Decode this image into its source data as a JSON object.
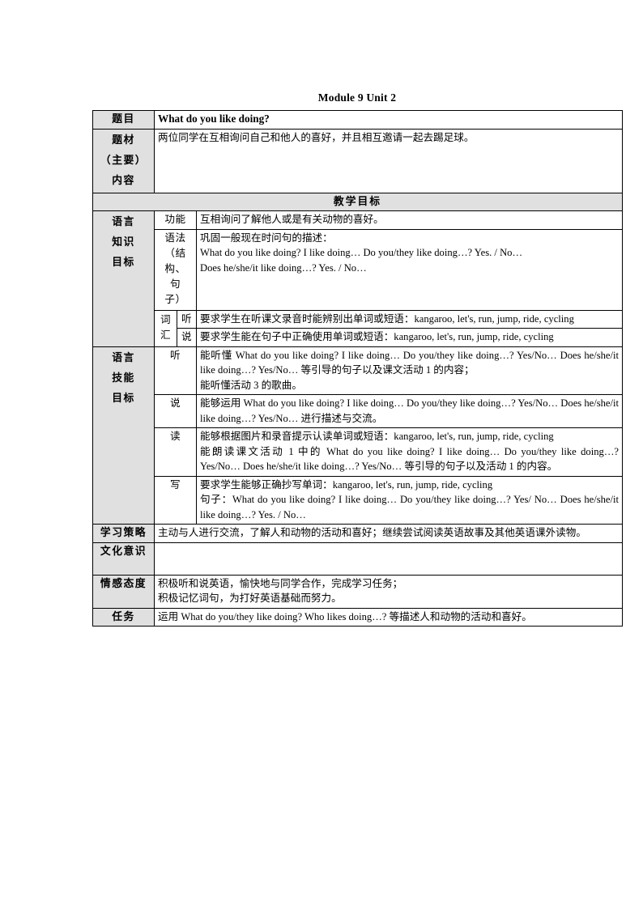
{
  "document": {
    "title": "Module 9 Unit 2"
  },
  "rows": {
    "topic": {
      "label": "题目",
      "value": "What do you like doing?"
    },
    "material": {
      "label_lines": [
        "题材",
        "（主要）",
        "内容"
      ],
      "value": "两位同学在互相询问自己和他人的喜好，并且相互邀请一起去踢足球。"
    },
    "teaching_goals_header": "教学目标",
    "language_knowledge": {
      "label_lines": [
        "语言",
        "知识",
        "目标"
      ],
      "function": {
        "sub_label": "功能",
        "value": "互相询问了解他人或是有关动物的喜好。"
      },
      "grammar": {
        "sub_label_lines": [
          "语法",
          "（结",
          "构、",
          "句",
          "子）"
        ],
        "lines": [
          "巩固一般现在时问句的描述：",
          "What do you like doing? I like doing… Do you/they like doing…? Yes. / No…",
          "Does he/she/it like doing…? Yes. / No…"
        ]
      },
      "vocabulary": {
        "sub_label_lines": [
          "词",
          "汇"
        ],
        "listen": {
          "sub_label": "听",
          "value": "要求学生在听课文录音时能辨别出单词或短语：kangaroo, let's, run, jump, ride, cycling"
        },
        "speak": {
          "sub_label": "说",
          "value": "要求学生能在句子中正确使用单词或短语：kangaroo, let's, run, jump, ride, cycling"
        }
      }
    },
    "language_skills": {
      "label_lines": [
        "语言",
        "技能",
        "目标"
      ],
      "listen": {
        "sub_label": "听",
        "lines": [
          "能听懂 What do you like doing? I like doing… Do you/they like doing…? Yes/No… Does he/she/it like doing…? Yes/No… 等引导的句子以及课文活动 1 的内容；",
          "能听懂活动 3 的歌曲。"
        ]
      },
      "speak": {
        "sub_label": "说",
        "lines": [
          "能够运用 What do you like doing? I like doing… Do you/they like doing…? Yes/No… Does he/she/it like doing…? Yes/No… 进行描述与交流。"
        ]
      },
      "read": {
        "sub_label": "读",
        "lines": [
          "能够根据图片和录音提示认读单词或短语：kangaroo, let's, run, jump, ride, cycling",
          "能朗读课文活动 1 中的 What do you like doing? I like doing… Do you/they like doing…? Yes/No… Does he/she/it like doing…? Yes/No… 等引导的句子以及活动 1 的内容。"
        ]
      },
      "write": {
        "sub_label": "写",
        "lines": [
          "要求学生能够正确抄写单词：kangaroo, let's, run, jump, ride, cycling",
          "句子：What do you like doing? I like doing… Do you/they like doing…? Yes/ No… Does he/she/it like doing…? Yes. / No…"
        ]
      }
    },
    "learning_strategy": {
      "label": "学习策略",
      "value": "主动与人进行交流，了解人和动物的活动和喜好；继续尝试阅读英语故事及其他英语课外读物。"
    },
    "cultural_awareness": {
      "label": "文化意识",
      "value": ""
    },
    "emotional_attitude": {
      "label": "情感态度",
      "lines": [
        "积极听和说英语，愉快地与同学合作，完成学习任务；",
        "积极记忆词句，为打好英语基础而努力。"
      ]
    },
    "task": {
      "label": "任务",
      "value": "运用 What do you/they like doing? Who likes doing…? 等描述人和动物的活动和喜好。"
    }
  },
  "colors": {
    "label_background": "#e0e0e0",
    "border": "#000000",
    "text": "#000000",
    "page_background": "#ffffff"
  }
}
